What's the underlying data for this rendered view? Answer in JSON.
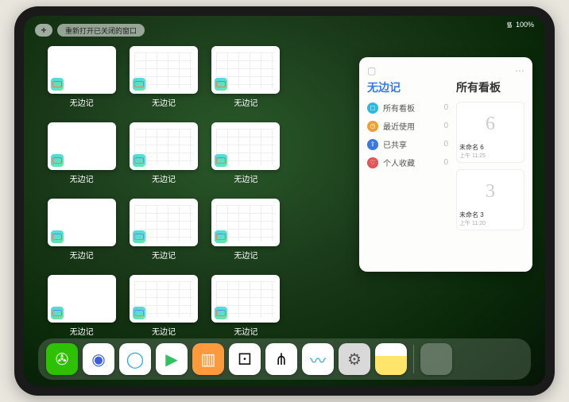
{
  "status": {
    "wifi": "᯾",
    "battery": "100%"
  },
  "controls": {
    "add": "+",
    "reopen_label": "重新打开已关闭的窗口"
  },
  "windows": [
    {
      "label": "无边记",
      "style": "blank"
    },
    {
      "label": "无边记",
      "style": "cal"
    },
    {
      "label": "无边记",
      "style": "cal"
    },
    {
      "label": "无边记",
      "style": "blank"
    },
    {
      "label": "无边记",
      "style": "cal"
    },
    {
      "label": "无边记",
      "style": "cal"
    },
    {
      "label": "无边记",
      "style": "blank"
    },
    {
      "label": "无边记",
      "style": "cal"
    },
    {
      "label": "无边记",
      "style": "cal"
    },
    {
      "label": "无边记",
      "style": "blank"
    },
    {
      "label": "无边记",
      "style": "cal"
    },
    {
      "label": "无边记",
      "style": "cal"
    }
  ],
  "panel": {
    "left_title": "无边记",
    "right_title": "所有看板",
    "items": [
      {
        "label": "所有看板",
        "count": "0",
        "color": "#2fb7e0",
        "glyph": "◻"
      },
      {
        "label": "最近使用",
        "count": "0",
        "color": "#f0a030",
        "glyph": "◷"
      },
      {
        "label": "已共享",
        "count": "0",
        "color": "#3a78e0",
        "glyph": "⇪"
      },
      {
        "label": "个人收藏",
        "count": "0",
        "color": "#e05555",
        "glyph": "♡"
      }
    ],
    "boards": [
      {
        "title": "未命名 6",
        "sub": "上午 11:25",
        "glyph": "6"
      },
      {
        "title": "未命名 3",
        "sub": "上午 11:20",
        "glyph": "3"
      }
    ]
  },
  "dock": [
    {
      "name": "wechat",
      "bg": "#2dc100",
      "glyph": "✇",
      "fg": "#fff"
    },
    {
      "name": "browser1",
      "bg": "#ffffff",
      "glyph": "◉",
      "fg": "#3a5fd9"
    },
    {
      "name": "browser2",
      "bg": "#ffffff",
      "glyph": "◯",
      "fg": "#2aa8e8"
    },
    {
      "name": "video",
      "bg": "#ffffff",
      "glyph": "▶",
      "fg": "#33c060"
    },
    {
      "name": "books",
      "bg": "#ff9a3c",
      "glyph": "▥",
      "fg": "#fff"
    },
    {
      "name": "dice",
      "bg": "#ffffff",
      "glyph": "⚀",
      "fg": "#111"
    },
    {
      "name": "nodes",
      "bg": "#ffffff",
      "glyph": "⋔",
      "fg": "#111"
    },
    {
      "name": "freeform",
      "bg": "#ffffff",
      "glyph": "〰",
      "fg": "#2aa8e8"
    },
    {
      "name": "settings",
      "bg": "#d9d9d9",
      "glyph": "⚙",
      "fg": "#555"
    },
    {
      "name": "notes",
      "bg": "linear-gradient(#fff 40%,#ffe66b 40%)",
      "glyph": "",
      "fg": "#333"
    }
  ]
}
